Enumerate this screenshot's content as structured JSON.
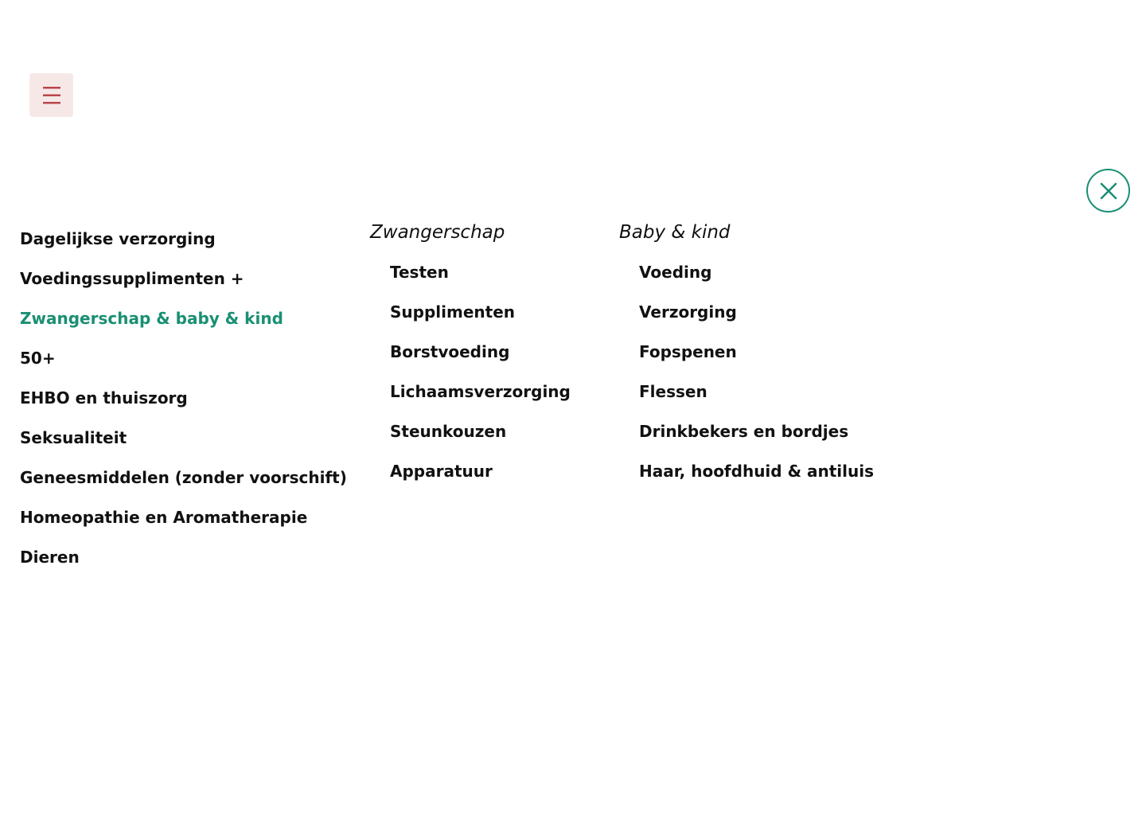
{
  "header": {
    "menu_icon": "hamburger-icon",
    "close_icon": "close-x-icon"
  },
  "colors": {
    "accent": "#1a8f73",
    "menu_button_bg": "#f7e8e8",
    "menu_icon": "#b8474c"
  },
  "nav": {
    "primary": [
      {
        "label": "Dagelijkse verzorging"
      },
      {
        "label": "Voedingssupplimenten +"
      },
      {
        "label": "Zwangerschap & baby & kind",
        "active": true
      },
      {
        "label": "50+"
      },
      {
        "label": "EHBO en thuiszorg"
      },
      {
        "label": "Seksualiteit"
      },
      {
        "label": "Geneesmiddelen (zonder voorschift)"
      },
      {
        "label": "Homeopathie en Aromatherapie"
      },
      {
        "label": "Dieren"
      }
    ],
    "columns": [
      {
        "title": "Zwangerschap",
        "items": [
          "Testen",
          "Supplimenten",
          "Borstvoeding",
          "Lichaamsverzorging",
          "Steunkouzen",
          "Apparatuur"
        ]
      },
      {
        "title": "Baby & kind",
        "items": [
          "Voeding",
          "Verzorging",
          "Fopspenen",
          "Flessen",
          "Drinkbekers en bordjes",
          "Haar, hoofdhuid & antiluis"
        ]
      }
    ]
  }
}
